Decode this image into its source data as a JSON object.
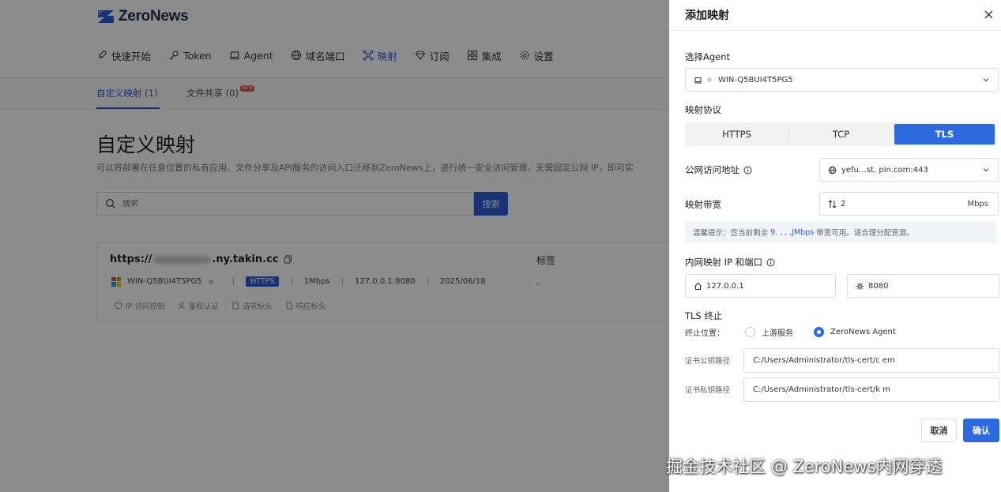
{
  "app": {
    "logo_text": "ZeroNews",
    "nav": [
      {
        "label": "快速开始",
        "icon": "rocket-icon"
      },
      {
        "label": "Token",
        "icon": "key-icon"
      },
      {
        "label": "Agent",
        "icon": "laptop-icon"
      },
      {
        "label": "域名端口",
        "icon": "globe-icon"
      },
      {
        "label": "映射",
        "icon": "network-icon",
        "active": true
      },
      {
        "label": "订阅",
        "icon": "diamond-icon"
      },
      {
        "label": "集成",
        "icon": "grid-icon"
      },
      {
        "label": "设置",
        "icon": "gear-icon"
      }
    ],
    "subtabs": [
      {
        "label": "自定义映射 (1)",
        "active": true
      },
      {
        "label": "文件共享 (0)",
        "badge": "NEW"
      }
    ],
    "page_title": "自定义映射",
    "page_desc": "可以将部署在任意位置的私有应用、文件分享及API服务的访问入口迁移到ZeroNews上，进行统一安全访问管理，无需固定公网 IP，即可实",
    "search": {
      "placeholder": "搜索",
      "button": "搜索"
    },
    "card": {
      "url_prefix": "https://",
      "url_suffix": ".ny.takin.cc",
      "tag_label": "标签",
      "tag_value": "-",
      "agent": "WIN-Q5BUI4T5PG5",
      "protocol": "HTTPS",
      "bandwidth": "1Mbps",
      "local": "127.0.0.1:8080",
      "date": "2025/06/18",
      "actions": [
        "IP 访问控制",
        "鉴权认证",
        "请求标头",
        "响应标头"
      ]
    }
  },
  "drawer": {
    "title": "添加映射",
    "agent_label": "选择Agent",
    "agent_value": "WIN-Q5BUI4T5PG5",
    "protocol_label": "映射协议",
    "protocols": [
      {
        "label": "HTTPS",
        "active": false
      },
      {
        "label": "TCP",
        "active": false
      },
      {
        "label": "TLS",
        "active": true
      }
    ],
    "public_addr_label": "公网访问地址",
    "public_addr_value": "yefu…st.    pin.com:443",
    "bandwidth_label": "映射带宽",
    "bandwidth_value": "2",
    "bandwidth_unit": "Mbps",
    "tip_prefix": "温馨提示：您当前剩余",
    "tip_value": "9. , , ,JMbps",
    "tip_suffix": "带宽可用。请合理分配资源。",
    "local_label": "内网映射 IP 和端口",
    "local_ip": "127.0.0.1",
    "local_port": "8080",
    "tls_label": "TLS 终止",
    "terminate_label": "终止位置：",
    "terminate_options": [
      {
        "label": "上游服务",
        "checked": false
      },
      {
        "label": "ZeroNews Agent",
        "checked": true
      }
    ],
    "cert_pub_label": "证书公钥路径",
    "cert_pub_value": "C:/Users/Administrator/tls-cert/c      em",
    "cert_key_label": "证书私钥路径",
    "cert_key_value": "C:/Users/Administrator/tls-cert/k      m",
    "cancel": "取消",
    "confirm": "确认"
  },
  "watermark": "掘金技术社区 @ ZeroNews内网穿透",
  "colors": {
    "accent": "#2d6ae0",
    "brand": "#2d5bd6"
  }
}
